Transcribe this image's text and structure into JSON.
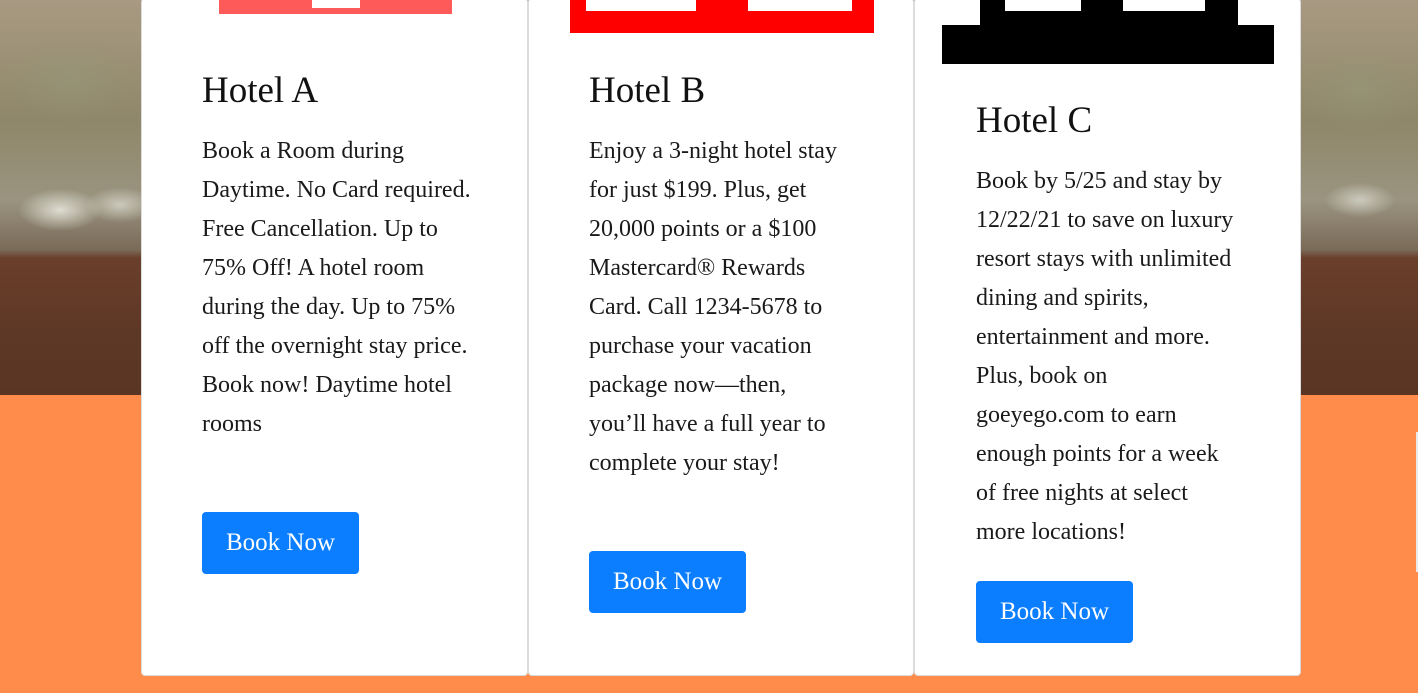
{
  "hotels": [
    {
      "name": "Hotel A",
      "description": "Book a Room during Daytime. No Card required. Free Cancellation. Up to 75% Off! A hotel room during the day. Up to 75% off the overnight stay price. Book now! Daytime hotel rooms",
      "button_label": "Book Now",
      "image_color": "#ff5a5a"
    },
    {
      "name": "Hotel B",
      "description": "Enjoy a 3-night hotel stay for just $199. Plus, get 20,000 points or a $100 Mastercard® Rewards Card. Call 1234-5678 to purchase your vacation package now—then, you’ll have a full year to complete your stay!",
      "button_label": "Book Now",
      "image_color": "#ff0000"
    },
    {
      "name": "Hotel C",
      "description": "Book by 5/25 and stay by 12/22/21 to save on luxury resort stays with unlimited dining and spirits, entertainment and more. Plus, book on goeyego.com to earn enough points for a week of free nights at select more locations!",
      "button_label": "Book Now",
      "image_color": "#000000"
    }
  ],
  "colors": {
    "accent_button": "#0a7eff",
    "page_background_bottom": "#ff8c4a"
  }
}
